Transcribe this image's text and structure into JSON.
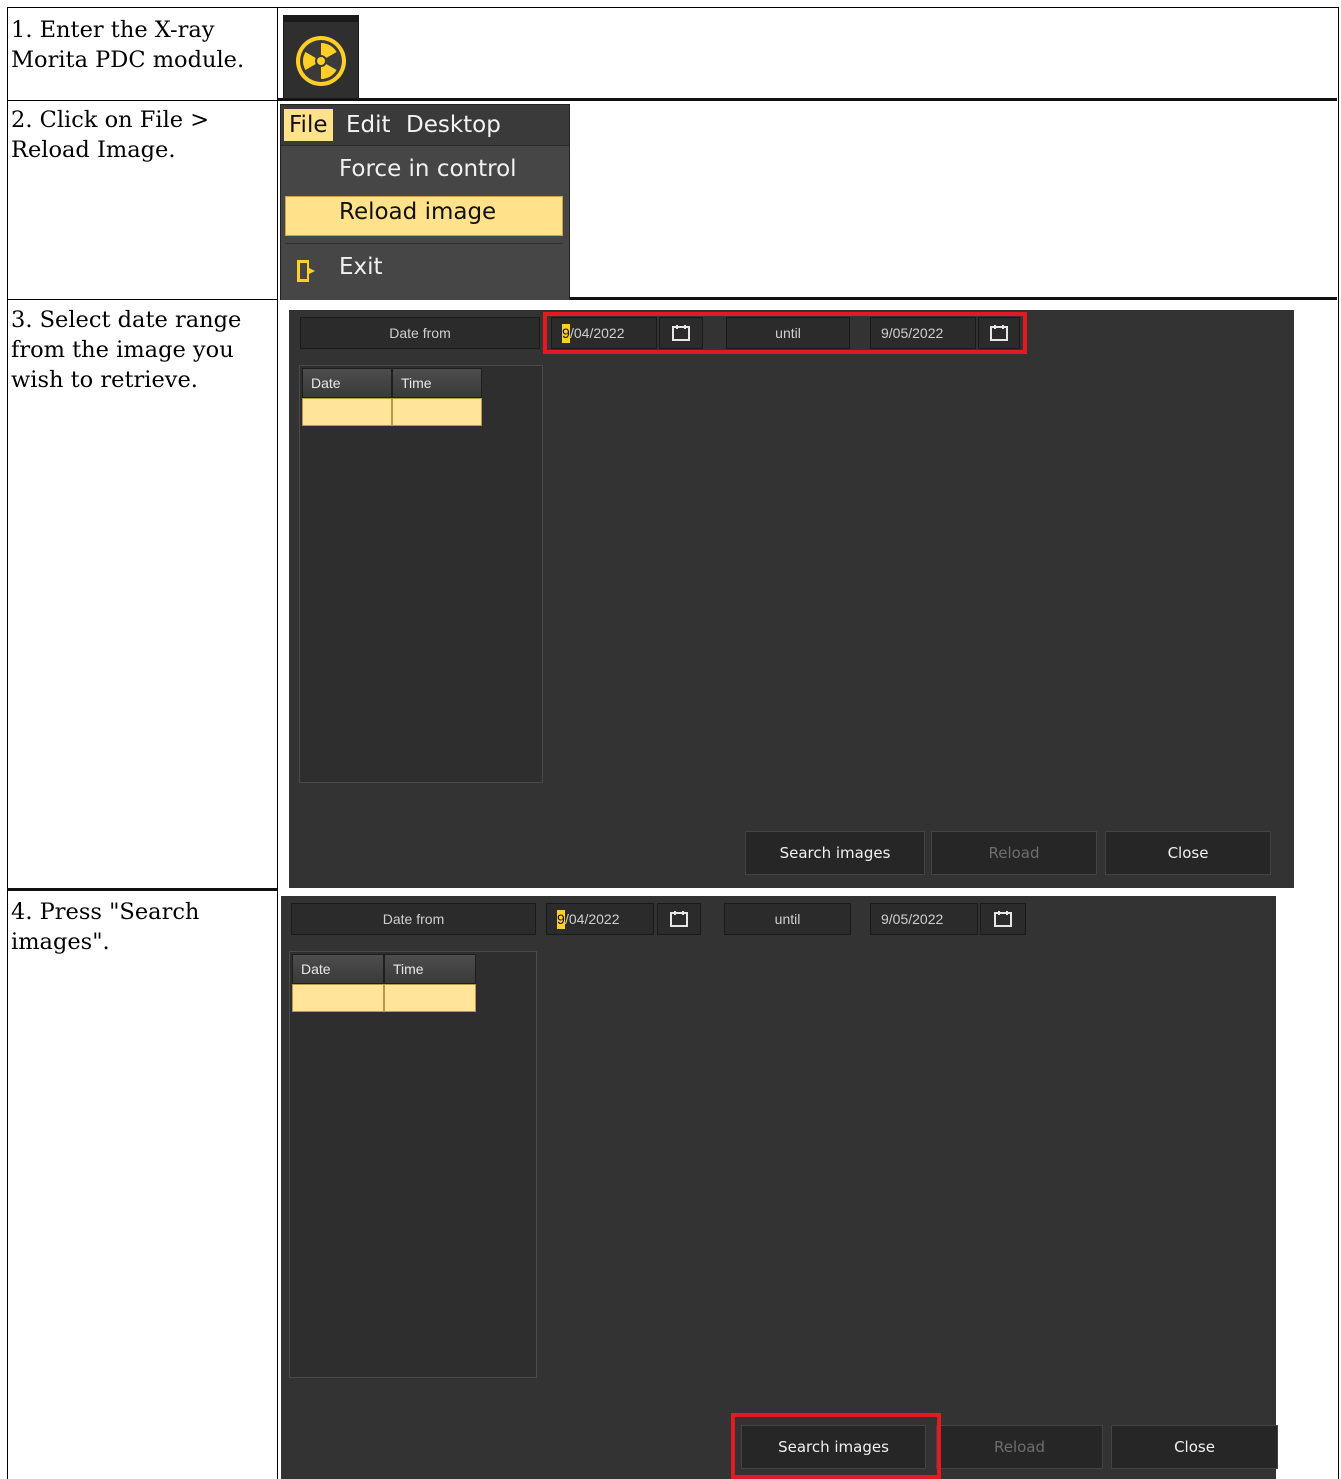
{
  "steps": [
    {
      "text": "1. Enter the X-ray Morita PDC module."
    },
    {
      "text": "2. Click on File > Reload Image."
    },
    {
      "text": "3. Select date range from the image you wish to retrieve."
    },
    {
      "text": "4. Press \"Search images\"."
    }
  ],
  "menu": {
    "bar": [
      "File",
      "Edit",
      "Desktop"
    ],
    "items": [
      "Force in control",
      "Reload image",
      "Exit"
    ]
  },
  "dialog": {
    "date_from_label": "Date from",
    "from_caret": "9",
    "from_rest": "/04/2022",
    "until_label": "until",
    "until_value": "9/05/2022",
    "columns": [
      "Date",
      "Time"
    ],
    "buttons": {
      "search": "Search images",
      "reload": "Reload",
      "close": "Close"
    }
  },
  "colors": {
    "highlight": "#ffe28a",
    "annotation": "#e21b23",
    "icon": "#ffcf27"
  },
  "icons": [
    "radiation-icon",
    "calendar-icon",
    "exit-door-icon"
  ]
}
